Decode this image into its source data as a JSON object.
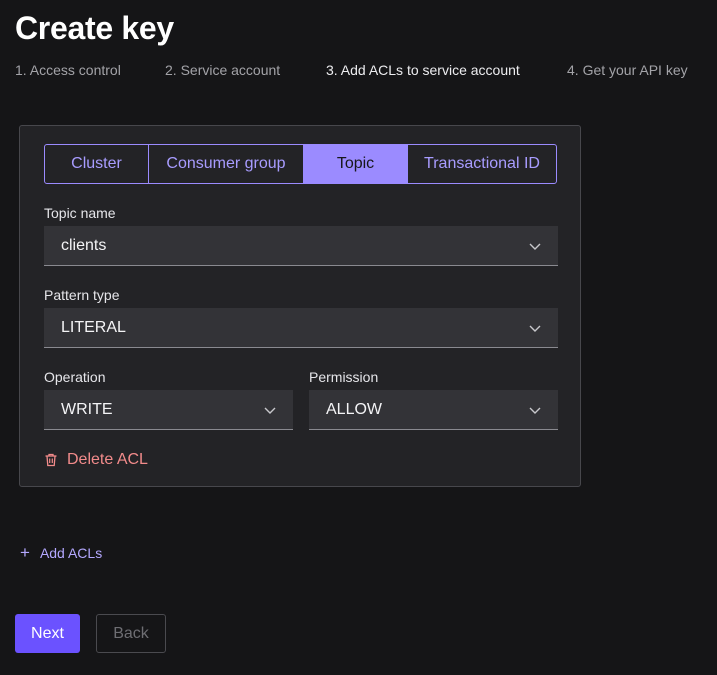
{
  "page": {
    "title": "Create key"
  },
  "steps": [
    {
      "label": "1. Access control",
      "active": false
    },
    {
      "label": "2. Service account",
      "active": false
    },
    {
      "label": "3. Add ACLs to service account",
      "active": true
    },
    {
      "label": "4. Get your API key",
      "active": false
    }
  ],
  "acl": {
    "tabs": [
      {
        "label": "Cluster",
        "selected": false
      },
      {
        "label": "Consumer group",
        "selected": false
      },
      {
        "label": "Topic",
        "selected": true
      },
      {
        "label": "Transactional ID",
        "selected": false
      }
    ],
    "topic_name": {
      "label": "Topic name",
      "value": "clients",
      "icon": "chevron-down-icon"
    },
    "pattern_type": {
      "label": "Pattern type",
      "value": "LITERAL",
      "icon": "chevron-down-icon"
    },
    "operation": {
      "label": "Operation",
      "value": "WRITE",
      "icon": "chevron-down-icon"
    },
    "permission": {
      "label": "Permission",
      "value": "ALLOW",
      "icon": "chevron-down-icon"
    },
    "delete_label": "Delete ACL",
    "delete_icon": "trash-icon"
  },
  "add_acls": {
    "label": "Add ACLs",
    "icon": "plus-icon"
  },
  "buttons": {
    "next_label": "Next",
    "back_label": "Back"
  },
  "colors": {
    "accent": "#6b52ff",
    "tab_accent": "#9b8bff",
    "danger": "#f28b8b",
    "background": "#151517",
    "card": "#232326"
  }
}
